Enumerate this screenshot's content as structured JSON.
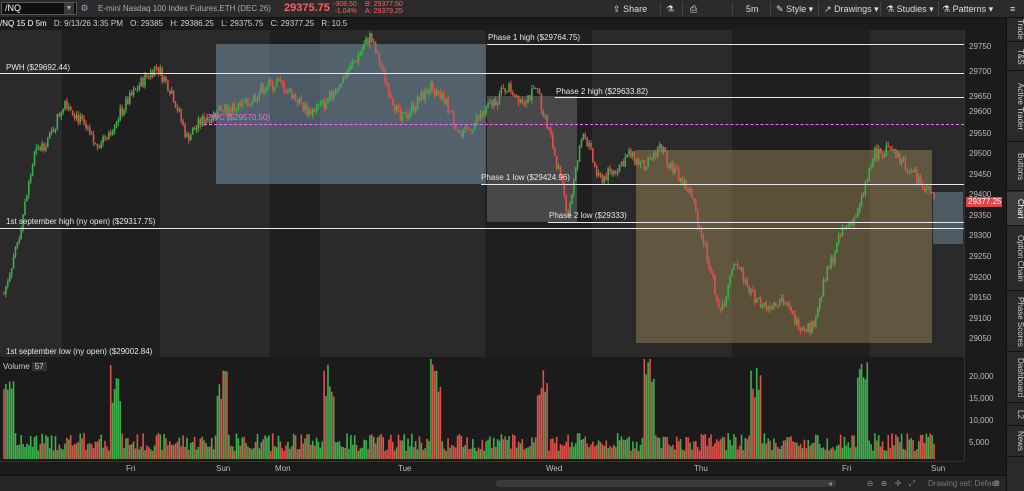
{
  "toolbar": {
    "symbol": "/NQ",
    "description": "E-mini Nasdaq 100 Index Futures,ETH (DEC 26)",
    "last_price": "29375.75",
    "net_change": "-308.50",
    "pct_change": "-1.04%",
    "bid": "B: 29377.50",
    "ask": "A: 29379.25",
    "share_label": "Share",
    "timeframe_label": "5m",
    "style_label": "Style",
    "drawings_label": "Drawings",
    "studies_label": "Studies",
    "patterns_label": "Patterns"
  },
  "info_row": {
    "symbol": "/NQ 15 D 5m",
    "date": "D: 9/13/26 3:35 PM",
    "open": "O: 29385",
    "high": "H: 29386.25",
    "low": "L: 29375.75",
    "close": "C: 29377.25",
    "range": "R: 10.5"
  },
  "levels": {
    "phase1_high": "Phase 1 high ($29764.75)",
    "phase2_high": "Phase 2 high ($29633.82)",
    "pwh": "PWH ($29692.44)",
    "pwc": "PWC ($29570.50)",
    "phase1_low": "Phase 1 low ($29424.96)",
    "phase2_low": "Phase 2 low ($29333)",
    "sept_high": "1st september high (ny open) ($29317.75)",
    "sept_low": "1st september low (ny open) ($29002.84)"
  },
  "price_axis": [
    "29750",
    "29700",
    "29650",
    "29600",
    "29550",
    "29500",
    "29450",
    "29400",
    "29350",
    "29300",
    "29250",
    "29200",
    "29150",
    "29100",
    "29050"
  ],
  "current_price_tag": "29377.25",
  "volume": {
    "label": "Volume",
    "value": "57",
    "axis": [
      "20,000",
      "15,000",
      "10,000",
      "5,000"
    ]
  },
  "x_axis": [
    "Fri",
    "Sun",
    "Mon",
    "Tue",
    "Wed",
    "Thu",
    "Fri",
    "Sun"
  ],
  "bottom_bar": {
    "drawing_set": "Drawing set: Default"
  },
  "sidebar": {
    "tabs": [
      "Trade",
      "T&S",
      "Active Trader",
      "Buttons",
      "Chart",
      "Option Chain",
      "Phase Scores",
      "Dashboard",
      "L2",
      "News"
    ]
  },
  "colors": {
    "up": "#3cb04c",
    "down": "#e0504c",
    "pwc_line": "#ff66ff",
    "price_tag": "#e04646",
    "phase_box_blue": "#9ec8e8",
    "phase_box_gold": "#c8aa6a"
  },
  "chart_data": {
    "type": "candlestick",
    "ylim": [
      29000,
      29775
    ],
    "series": [
      {
        "x": "Fri",
        "y": 29150
      },
      {
        "y": 29290
      },
      {
        "y": 29480
      },
      {
        "y": 29520
      },
      {
        "y": 29610
      },
      {
        "y": 29560
      },
      {
        "y": 29500
      },
      {
        "y": 29540
      },
      {
        "y": 29600
      },
      {
        "y": 29650
      },
      {
        "y": 29690
      },
      {
        "y": 29630
      },
      {
        "y": 29520
      },
      {
        "y": 29560
      },
      {
        "x": "Sun",
        "y": 29580
      },
      {
        "y": 29590
      },
      {
        "y": 29600
      },
      {
        "y": 29640
      },
      {
        "x": "Mon",
        "y": 29650
      },
      {
        "y": 29620
      },
      {
        "y": 29580
      },
      {
        "y": 29600
      },
      {
        "y": 29650
      },
      {
        "y": 29700
      },
      {
        "y": 29760
      },
      {
        "y": 29660
      },
      {
        "x": "Tue",
        "y": 29560
      },
      {
        "y": 29600
      },
      {
        "y": 29640
      },
      {
        "y": 29600
      },
      {
        "y": 29520
      },
      {
        "y": 29560
      },
      {
        "y": 29600
      },
      {
        "y": 29640
      },
      {
        "y": 29610
      },
      {
        "y": 29630
      },
      {
        "x": "Wed",
        "y": 29500
      },
      {
        "y": 29340
      },
      {
        "y": 29540
      },
      {
        "y": 29420
      },
      {
        "y": 29440
      },
      {
        "y": 29480
      },
      {
        "y": 29450
      },
      {
        "y": 29500
      },
      {
        "y": 29440
      },
      {
        "y": 29390
      },
      {
        "x": "Thu",
        "y": 29260
      },
      {
        "y": 29100
      },
      {
        "y": 29230
      },
      {
        "y": 29150
      },
      {
        "y": 29120
      },
      {
        "y": 29140
      },
      {
        "y": 29080
      },
      {
        "y": 29070
      },
      {
        "y": 29200
      },
      {
        "y": 29300
      },
      {
        "x": "Fri",
        "y": 29340
      },
      {
        "y": 29480
      },
      {
        "y": 29490
      },
      {
        "y": 29460
      },
      {
        "y": 29420
      },
      {
        "x": "Sun",
        "y": 29377
      }
    ]
  }
}
